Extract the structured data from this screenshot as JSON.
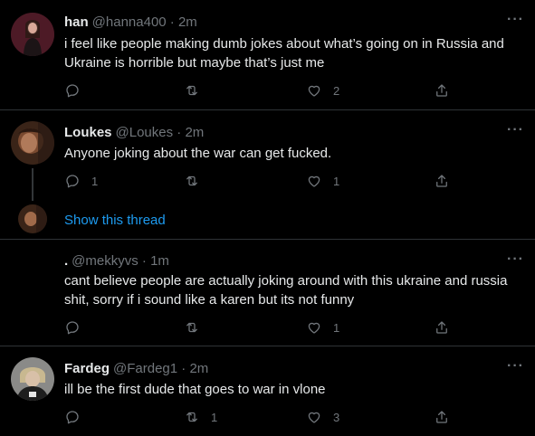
{
  "tweets": [
    {
      "name": "han",
      "handle": "@hanna400 · 2m",
      "text": "i feel like people making dumb jokes about what’s going on in Russia and Ukraine is horrible but maybe that’s just me",
      "replies": "",
      "retweets": "",
      "likes": "2"
    },
    {
      "name": "Loukes",
      "handle": "@Loukes · 2m",
      "text": "Anyone joking about the war can get fucked.",
      "replies": "1",
      "retweets": "",
      "likes": "1"
    },
    {
      "name": ".",
      "handle": "@mekkyvs · 1m",
      "text": "cant believe people are actually joking around with this ukraine and russia shit, sorry if i sound like a karen but its not funny",
      "replies": "",
      "retweets": "",
      "likes": "1"
    },
    {
      "name": "Fardeg",
      "handle": "@Fardeg1 · 2m",
      "text": "ill be the first dude that goes to war in vlone",
      "replies": "",
      "retweets": "1",
      "likes": "3"
    }
  ],
  "thread": {
    "label": "Show this thread"
  },
  "more_label": "···",
  "colors": {
    "background": "#000000",
    "text": "#e7e9ea",
    "muted": "#71767b",
    "link": "#1d9bf0",
    "divider": "#2f3336"
  },
  "icons": [
    "reply-icon",
    "retweet-icon",
    "like-icon",
    "share-icon",
    "more-icon"
  ]
}
